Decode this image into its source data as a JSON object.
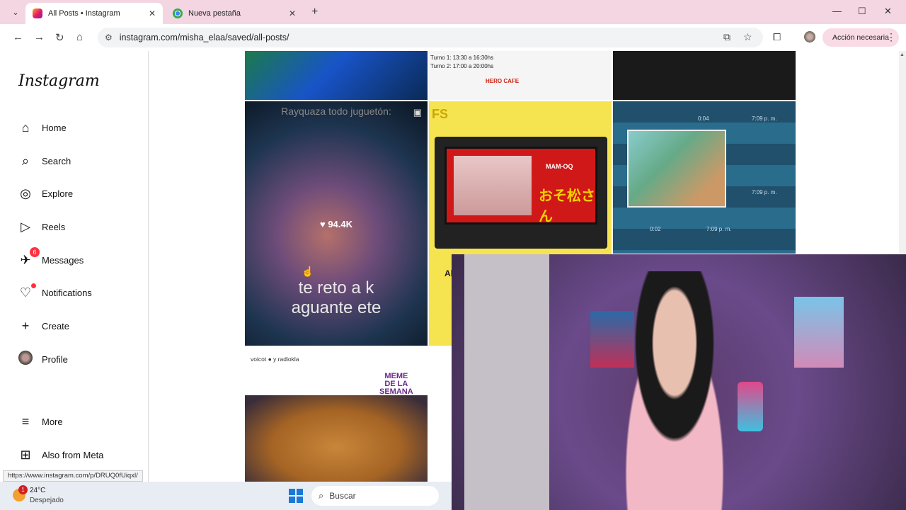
{
  "browser": {
    "tabs": [
      {
        "title": "All Posts • Instagram",
        "active": true
      },
      {
        "title": "Nueva pestaña",
        "active": false
      }
    ],
    "url": "instagram.com/misha_elaa/saved/all-posts/",
    "action_button": "Acción necesaria",
    "status_url": "https://www.instagram.com/p/DRUQ0fUiqxl/"
  },
  "sidebar": {
    "logo": "Instagram",
    "items": [
      {
        "label": "Home",
        "icon": "home-icon"
      },
      {
        "label": "Search",
        "icon": "search-icon"
      },
      {
        "label": "Explore",
        "icon": "compass-icon"
      },
      {
        "label": "Reels",
        "icon": "reels-icon"
      },
      {
        "label": "Messages",
        "icon": "messenger-icon",
        "badge": "6"
      },
      {
        "label": "Notifications",
        "icon": "heart-icon"
      },
      {
        "label": "Create",
        "icon": "plus-icon"
      },
      {
        "label": "Profile",
        "icon": "avatar"
      },
      {
        "label": "More",
        "icon": "menu-icon"
      },
      {
        "label": "Also from Meta",
        "icon": "meta-apps-icon"
      }
    ]
  },
  "posts": {
    "hero_turnos": [
      "Turno 1: 13:30 a 16:30hs",
      "Turno 2: 17:00 a 20:00hs"
    ],
    "hero_brand": "HERO CAFE",
    "reel_top_caption": "Rayquaza todo juguetón:",
    "reel_likes": "94.4K",
    "reel_bottom_caption_1": "te reto a k",
    "reel_bottom_caption_2": "aguante ete",
    "cartridge_fs": "FS",
    "cartridge_title": "MAM-OQ",
    "cartridge_logo": "おそ松さん",
    "cartridge_partial": "Al",
    "wa_times": [
      "0:04",
      "7:09 p. m.",
      "7:09 p. m.",
      "0:02",
      "7:09 p. m."
    ],
    "voicot_header": "voicot ● y radiokla",
    "meme_lines": [
      "MEME",
      "DE LA",
      "SEMANA"
    ]
  },
  "taskbar": {
    "weather_badge": "1",
    "temperature": "24°C",
    "condition": "Despejado",
    "search_placeholder": "Buscar"
  },
  "colors": {
    "tabbar_bg": "#f3d6e2",
    "notification_red": "#ff3040",
    "taskbar_bg": "#e8ecf3"
  }
}
